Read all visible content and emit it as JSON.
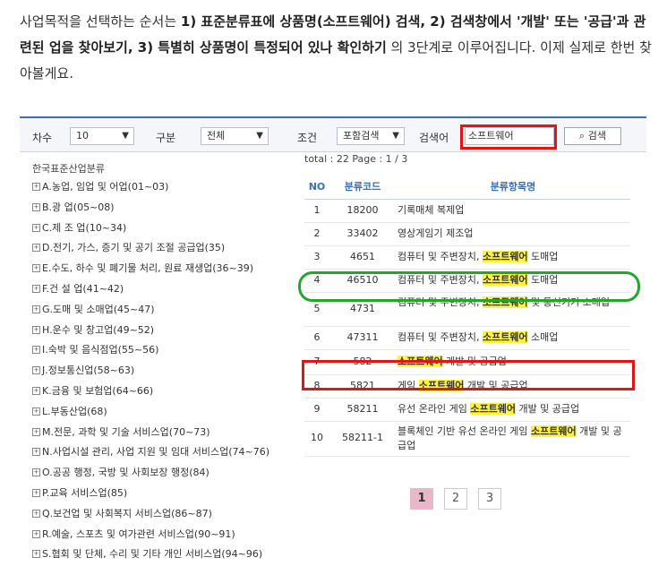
{
  "intro": {
    "p1": "사업목적을 선택하는 순서는 ",
    "b1": "1) 표준분류표에 상품명(소프트웨어) 검색, 2) 검색창에서 '개발' 또는 '공급'과 관련된 업을 찾아보기, 3) 특별히 상품명이 특정되어 있나 확인하기",
    "p2": " 의 3단계로 이루어집니다. 이제 실제로 한번 찾아볼게요."
  },
  "searchbar": {
    "chasu_label": "차수",
    "chasu_value": "10",
    "gubun_label": "구분",
    "gubun_value": "전체",
    "condition_label": "조건",
    "condition_value": "포함검색",
    "keyword_label": "검색어",
    "keyword_value": "소프트웨어",
    "search_button": "검색"
  },
  "tree": {
    "title": "한국표준산업분류",
    "items": [
      "A.농업, 임업 및 어업(01~03)",
      "B.광 업(05~08)",
      "C.제 조 업(10~34)",
      "D.전기, 가스, 증기 및 공기 조절 공급업(35)",
      "E.수도, 하수 및 폐기물 처리, 원료 재생업(36~39)",
      "F.건 설 업(41~42)",
      "G.도매 및 소매업(45~47)",
      "H.운수 및 창고업(49~52)",
      "I.숙박 및 음식점업(55~56)",
      "J.정보통신업(58~63)",
      "K.금융 및 보험업(64~66)",
      "L.부동산업(68)",
      "M.전문, 과학 및 기술 서비스업(70~73)",
      "N.사업시설 관리, 사업 지원 및 임대 서비스업(74~76)",
      "O.공공 행정, 국방 및 사회보장 행정(84)",
      "P.교육 서비스업(85)",
      "Q.보건업 및 사회복지 서비스업(86~87)",
      "R.예술, 스포츠 및 여가관련 서비스업(90~91)",
      "S.협회 및 단체, 수리 및 기타 개인 서비스업(94~96)"
    ]
  },
  "results": {
    "total": "total : 22     Page : 1 / 3",
    "headers": [
      "NO",
      "분류코드",
      "분류항목명"
    ],
    "rows": [
      {
        "no": "1",
        "code": "18200",
        "pre": "기록매체 복제업",
        "hl": "",
        "post": ""
      },
      {
        "no": "2",
        "code": "33402",
        "pre": "영상게임기 제조업",
        "hl": "",
        "post": ""
      },
      {
        "no": "3",
        "code": "4651",
        "pre": "컴퓨터 및 주변장치, ",
        "hl": "소프트웨어",
        "post": " 도매업"
      },
      {
        "no": "4",
        "code": "46510",
        "pre": "컴퓨터 및 주변장치, ",
        "hl": "소프트웨어",
        "post": " 도매업"
      },
      {
        "no": "5",
        "code": "4731",
        "pre": "컴퓨터 및 주변장치, ",
        "hl": "소프트웨어",
        "post": " 및 통신기기 소매업"
      },
      {
        "no": "6",
        "code": "47311",
        "pre": "컴퓨터 및 주변장치, ",
        "hl": "소프트웨어",
        "post": " 소매업"
      },
      {
        "no": "7",
        "code": "582",
        "pre": "",
        "hl": "소프트웨어",
        "post": " 개발 및 공급업"
      },
      {
        "no": "8",
        "code": "5821",
        "pre": "게임 ",
        "hl": "소프트웨어",
        "post": " 개발 및 공급업"
      },
      {
        "no": "9",
        "code": "58211",
        "pre": "유선 온라인 게임 ",
        "hl": "소프트웨어",
        "post": " 개발 및 공급업"
      },
      {
        "no": "10",
        "code": "58211-1",
        "pre": "블록체인 기반 유선 온라인 게임 ",
        "hl": "소프트웨어",
        "post": " 개발 및 공급업"
      }
    ]
  },
  "pagination": {
    "pages": [
      "1",
      "2",
      "3"
    ],
    "current": "1"
  }
}
